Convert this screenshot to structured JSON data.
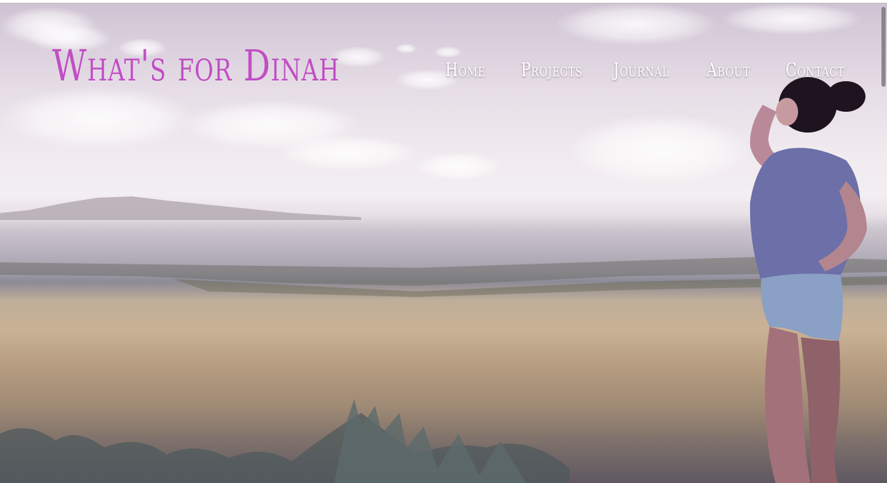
{
  "site": {
    "title": "What's for Dinah",
    "brand_color": "#c04fc4"
  },
  "nav": {
    "items": [
      {
        "label": "Home"
      },
      {
        "label": "Projects"
      },
      {
        "label": "Journal"
      },
      {
        "label": "About"
      },
      {
        "label": "Contact"
      }
    ],
    "text_color": "#ffffff"
  },
  "hero": {
    "image_subject": "woman looking out over a lake and grassland at sunset"
  }
}
